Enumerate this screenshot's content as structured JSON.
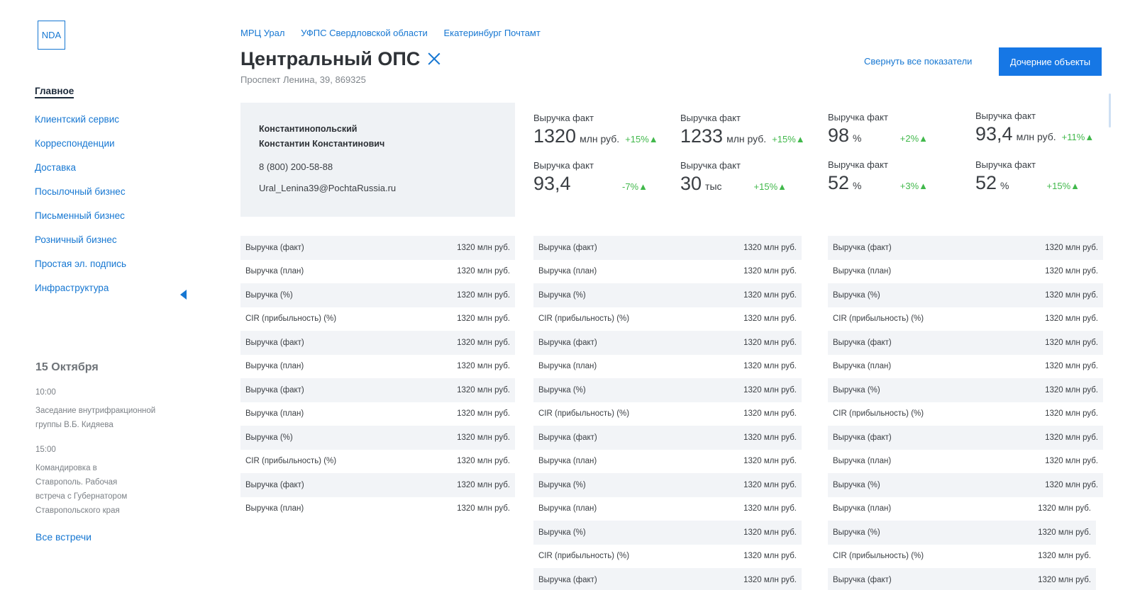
{
  "logo": "NDA",
  "nav": {
    "items": [
      {
        "label": "Главное",
        "active": true
      },
      {
        "label": "Клиентский сервис"
      },
      {
        "label": "Корреспонденции"
      },
      {
        "label": "Доставка"
      },
      {
        "label": "Посылочный бизнес"
      },
      {
        "label": "Письменный бизнес"
      },
      {
        "label": "Розничный бизнес"
      },
      {
        "label": "Простая эл. подпись"
      },
      {
        "label": "Инфраструктура"
      }
    ]
  },
  "calendar": {
    "date": "15 Октября",
    "events": [
      {
        "time": "10:00",
        "text": "Заседание внутрифракционной группы В.Б. Кидяева"
      },
      {
        "time": "15:00",
        "text": "Командировка в Ставрополь. Рабочая встреча с Губернатором Ставропольского края"
      }
    ],
    "all_link": "Все встречи"
  },
  "breadcrumbs": [
    "МРЦ Урал",
    "УФПС Свердловской области",
    "Екатеринбург Почтамт"
  ],
  "header": {
    "title": "Центральный ОПС",
    "address": "Проспект Ленина, 39, 869325",
    "collapse_label": "Свернуть все показатели",
    "child_objects_label": "Дочерние объекты"
  },
  "contact": {
    "name_line1": "Константинопольский",
    "name_line2": "Константин Константинович",
    "phone": "8 (800) 200-58-88",
    "email": "Ural_Lenina39@PochtaRussia.ru"
  },
  "kpis": [
    {
      "label": "Выручка факт",
      "value": "1320",
      "unit": "млн руб.",
      "delta": "+15%▲"
    },
    {
      "label": "Выручка факт",
      "value": "1233",
      "unit": "млн руб.",
      "delta": "+15%▲"
    },
    {
      "label": "Выручка факт",
      "value": "98",
      "unit": "%",
      "delta": "+2%▲"
    },
    {
      "label": "Выручка факт",
      "value": "93,4",
      "unit": "млн руб.",
      "delta": "+11%▲"
    },
    {
      "label": "Выручка факт",
      "value": "93,4",
      "unit": "",
      "delta": "-7%▲"
    },
    {
      "label": "Выручка факт",
      "value": "30",
      "unit": "тыс",
      "delta": "+15%▲"
    },
    {
      "label": "Выручка факт",
      "value": "52",
      "unit": "%",
      "delta": "+3%▲"
    },
    {
      "label": "Выручка факт",
      "value": "52",
      "unit": "%",
      "delta": "+15%▲"
    }
  ],
  "tables": [
    [
      [
        "Выручка (факт)",
        "1320 млн руб."
      ],
      [
        "Выручка (план)",
        "1320 млн руб."
      ],
      [
        "Выручка (%)",
        "1320 млн руб."
      ],
      [
        "CIR (прибыльность) (%)",
        "1320 млн руб."
      ],
      [
        "Выручка (факт)",
        "1320 млн руб."
      ],
      [
        "Выручка (план)",
        "1320 млн руб."
      ],
      [
        "Выручка (факт)",
        "1320 млн руб."
      ],
      [
        "Выручка (план)",
        "1320 млн руб."
      ],
      [
        "Выручка (%)",
        "1320 млн руб."
      ],
      [
        "CIR (прибыльность) (%)",
        "1320 млн руб."
      ],
      [
        "Выручка (факт)",
        "1320 млн руб."
      ],
      [
        "Выручка (план)",
        "1320 млн руб."
      ]
    ],
    [
      [
        "Выручка (факт)",
        "1320 млн руб."
      ],
      [
        "Выручка (план)",
        "1320 млн руб."
      ],
      [
        "Выручка (%)",
        "1320 млн руб."
      ],
      [
        "CIR (прибыльность) (%)",
        "1320 млн руб."
      ],
      [
        "Выручка (факт)",
        "1320 млн руб."
      ],
      [
        "Выручка (план)",
        "1320 млн руб."
      ],
      [
        "Выручка (%)",
        "1320 млн руб."
      ],
      [
        "CIR (прибыльность) (%)",
        "1320 млн руб."
      ],
      [
        "Выручка (факт)",
        "1320 млн руб."
      ],
      [
        "Выручка (план)",
        "1320 млн руб."
      ],
      [
        "Выручка (%)",
        "1320 млн руб."
      ],
      [
        "Выручка (план)",
        "1320 млн руб."
      ],
      [
        "Выручка (%)",
        "1320 млн руб."
      ],
      [
        "CIR (прибыльность) (%)",
        "1320 млн руб."
      ],
      [
        "Выручка (факт)",
        "1320 млн руб."
      ]
    ],
    [
      [
        "Выручка (факт)",
        "1320 млн руб."
      ],
      [
        "Выручка (план)",
        "1320 млн руб."
      ],
      [
        "Выручка (%)",
        "1320 млн руб."
      ],
      [
        "CIR (прибыльность) (%)",
        "1320 млн руб."
      ],
      [
        "Выручка (факт)",
        "1320 млн руб."
      ],
      [
        "Выручка (план)",
        "1320 млн руб."
      ],
      [
        "Выручка (%)",
        "1320 млн руб."
      ],
      [
        "CIR (прибыльность) (%)",
        "1320 млн руб."
      ],
      [
        "Выручка (факт)",
        "1320 млн руб."
      ],
      [
        "Выручка (план)",
        "1320 млн руб."
      ],
      [
        "Выручка (%)",
        "1320 млн руб."
      ],
      [
        "Выручка (план)",
        "1320 млн руб."
      ],
      [
        "Выручка (%)",
        "1320 млн руб."
      ],
      [
        "CIR (прибыльность) (%)",
        "1320 млн руб."
      ],
      [
        "Выручка (факт)",
        "1320 млн руб."
      ]
    ]
  ],
  "colors": {
    "accent": "#1677d2",
    "positive": "#41b84b",
    "panel": "#eff2f5",
    "row_shade": "#f2f4f7"
  }
}
